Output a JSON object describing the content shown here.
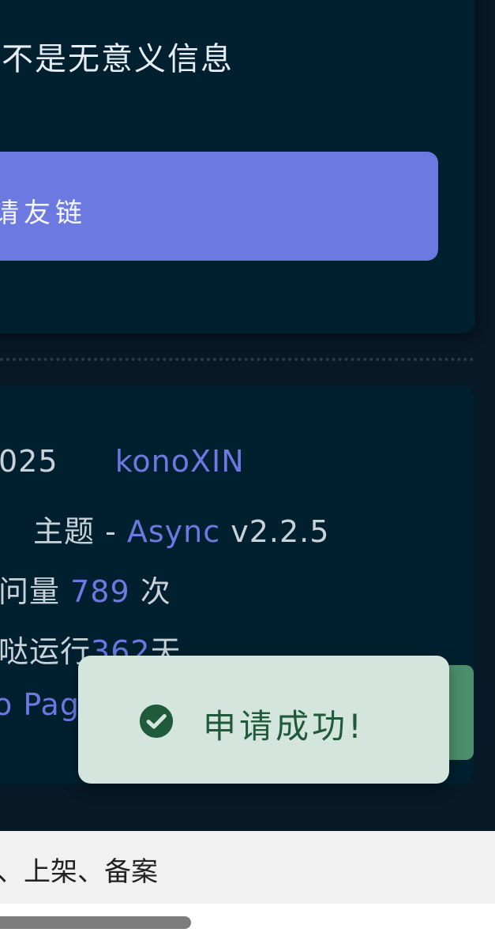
{
  "notice": {
    "text": "不是无意义信息"
  },
  "apply_button": {
    "label": "请友链"
  },
  "footer": {
    "copyright_year_partial": "025",
    "author": "konoXIN",
    "theme_prefix": "主题 - ",
    "theme_name": "Async",
    "theme_version": " v2.2.5",
    "visits_prefix": "问量 ",
    "visits_count": "789",
    "visits_suffix": " 次",
    "runtime_prefix": "哒运行",
    "runtime_days": "362",
    "runtime_suffix": "天",
    "hosting_partial": "o Pag"
  },
  "toast": {
    "message": "申请成功!",
    "icon": "check-circle-icon",
    "color": "#1f5b3a"
  },
  "bottom_bar": {
    "text": "、上架、备案"
  },
  "colors": {
    "accent": "#6b79e1",
    "card_bg": "#01202f",
    "page_bg": "#071827",
    "toast_bg": "#d3e5dc"
  }
}
